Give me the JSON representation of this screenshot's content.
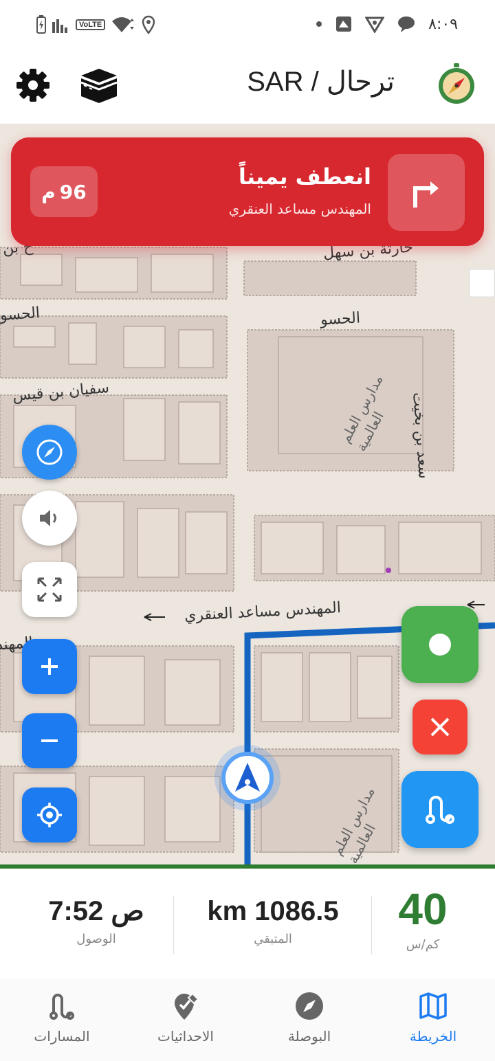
{
  "status_bar": {
    "time": "٨:٠٩",
    "network_badge": "VoLTE"
  },
  "app_bar": {
    "title": "SAR / ترحال"
  },
  "turn": {
    "instruction": "انعطف يميناً",
    "street": "المهندس مساعد العنقري",
    "distance_value": "96",
    "distance_unit": "م"
  },
  "map": {
    "labels": {
      "street_top": "حارثة بن سهل",
      "street_left_top": "ح بن",
      "hasw_left": "الحسو",
      "hasw_center": "الحسو",
      "sufyan": "سفيان بن قيس",
      "saad": "سعد بن بخيت",
      "school_1": "مدارس العلم العالمية",
      "main_street": "المهندس مساعد العنقري",
      "left_edge": "المهند",
      "school_2": "مدارس العلم العالمية"
    },
    "route_color": "#1565c0"
  },
  "stats": {
    "speed_value": "40",
    "speed_unit": "كم/س",
    "remaining_value": "km 1086.5",
    "remaining_label": "المتبقي",
    "arrival_value": "7:52 ص",
    "arrival_label": "الوصول"
  },
  "nav": {
    "map": "الخريطة",
    "compass": "البوصلة",
    "coordinates": "الاحداثيات",
    "routes": "المسارات"
  },
  "colors": {
    "banner": "#d7282f",
    "accent_blue": "#1d7bf2",
    "speed_green": "#2e7d32",
    "record_green": "#4caf50",
    "stop_red": "#f44336"
  }
}
